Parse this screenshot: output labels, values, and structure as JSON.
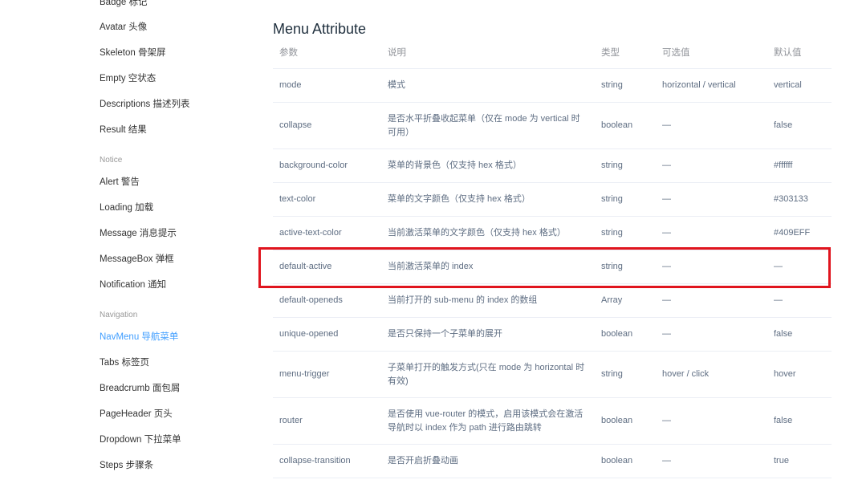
{
  "sidebar": {
    "items": [
      {
        "label": "Badge 标记",
        "active": false
      },
      {
        "label": "Avatar 头像",
        "active": false
      },
      {
        "label": "Skeleton 骨架屏",
        "active": false
      },
      {
        "label": "Empty 空状态",
        "active": false
      },
      {
        "label": "Descriptions 描述列表",
        "active": false
      },
      {
        "label": "Result 结果",
        "active": false
      },
      {
        "group": "Notice"
      },
      {
        "label": "Alert 警告",
        "active": false
      },
      {
        "label": "Loading 加载",
        "active": false
      },
      {
        "label": "Message 消息提示",
        "active": false
      },
      {
        "label": "MessageBox 弹框",
        "active": false
      },
      {
        "label": "Notification 通知",
        "active": false
      },
      {
        "group": "Navigation"
      },
      {
        "label": "NavMenu 导航菜单",
        "active": true
      },
      {
        "label": "Tabs 标签页",
        "active": false
      },
      {
        "label": "Breadcrumb 面包屑",
        "active": false
      },
      {
        "label": "PageHeader 页头",
        "active": false
      },
      {
        "label": "Dropdown 下拉菜单",
        "active": false
      },
      {
        "label": "Steps 步骤条",
        "active": false
      }
    ]
  },
  "main": {
    "title": "Menu Attribute",
    "columns": [
      "参数",
      "说明",
      "类型",
      "可选值",
      "默认值"
    ],
    "rows": [
      [
        "mode",
        "模式",
        "string",
        "horizontal / vertical",
        "vertical"
      ],
      [
        "collapse",
        "是否水平折叠收起菜单（仅在 mode 为 vertical 时可用）",
        "boolean",
        "—",
        "false"
      ],
      [
        "background-color",
        "菜单的背景色（仅支持 hex 格式）",
        "string",
        "—",
        "#ffffff"
      ],
      [
        "text-color",
        "菜单的文字颜色（仅支持 hex 格式）",
        "string",
        "—",
        "#303133"
      ],
      [
        "active-text-color",
        "当前激活菜单的文字颜色（仅支持 hex 格式）",
        "string",
        "—",
        "#409EFF"
      ],
      [
        "default-active",
        "当前激活菜单的 index",
        "string",
        "—",
        "—"
      ],
      [
        "default-openeds",
        "当前打开的 sub-menu 的 index 的数组",
        "Array",
        "—",
        "—"
      ],
      [
        "unique-opened",
        "是否只保持一个子菜单的展开",
        "boolean",
        "—",
        "false"
      ],
      [
        "menu-trigger",
        "子菜单打开的触发方式(只在 mode 为 horizontal 时有效)",
        "string",
        "hover / click",
        "hover"
      ],
      [
        "router",
        "是否使用 vue-router 的模式，启用该模式会在激活导航时以 index 作为 path 进行路由跳转",
        "boolean",
        "—",
        "false"
      ],
      [
        "collapse-transition",
        "是否开启折叠动画",
        "boolean",
        "—",
        "true"
      ]
    ],
    "highlighted_row": "default-active"
  },
  "colors": {
    "accent": "#409EFF",
    "highlight_border": "#e0141e"
  }
}
